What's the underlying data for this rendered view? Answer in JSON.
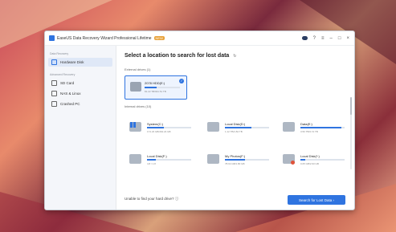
{
  "window": {
    "title": "EaseUS Data Recovery Wizard Professional Lifetime",
    "badge": "NEW",
    "buttons": {
      "menu": "≡",
      "minimize": "–",
      "maximize": "□",
      "close": "×",
      "help": "?"
    }
  },
  "sidebar": {
    "section_1": "Data Recovery",
    "section_2": "Advanced Recovery",
    "items": [
      {
        "label": "Hardware Disk",
        "active": true,
        "icon": "hard-disk-icon"
      },
      {
        "label": "SD Card",
        "active": false,
        "icon": "sd-card-icon"
      },
      {
        "label": "NAS & Linux",
        "active": false,
        "icon": "nas-icon"
      },
      {
        "label": "Crashed PC",
        "active": false,
        "icon": "crashed-pc-icon"
      }
    ]
  },
  "main": {
    "heading": "Select a location to search for lost data",
    "external_label": "External drives (1)",
    "internal_label": "Internal drives (10)",
    "external": {
      "name": "2078 HDD(E:)",
      "size": "81.22 TB/931.51 TB",
      "used": 0.35
    },
    "drives": [
      {
        "name": "System(C:)",
        "size": "174.23 GB/464.24 GB",
        "used": 0.38,
        "icon": "windows-drive-icon"
      },
      {
        "name": "Local Disk(D:)",
        "size": "1.12 TB/1.82 TB",
        "used": 0.6,
        "icon": "drive-icon"
      },
      {
        "name": "Data(E:)",
        "size": "3.56 TB/3.72 TB",
        "used": 0.92,
        "icon": "drive-icon"
      },
      {
        "name": "Local Disk(F:)",
        "size": "4.8 / 1.8",
        "used": 0.2,
        "icon": "drive-icon"
      },
      {
        "name": "My Photos(F:)",
        "size": "78.94 GB/1.80 GB",
        "used": 0.45,
        "icon": "drive-icon"
      },
      {
        "name": "Local Disk(*:)",
        "size": "0.05 GB/2.93 GB",
        "used": 0.1,
        "icon": "warning-drive-icon"
      }
    ],
    "footer_text": "Unable to find your hard drive?",
    "search_button": "Search for Lost Data"
  }
}
